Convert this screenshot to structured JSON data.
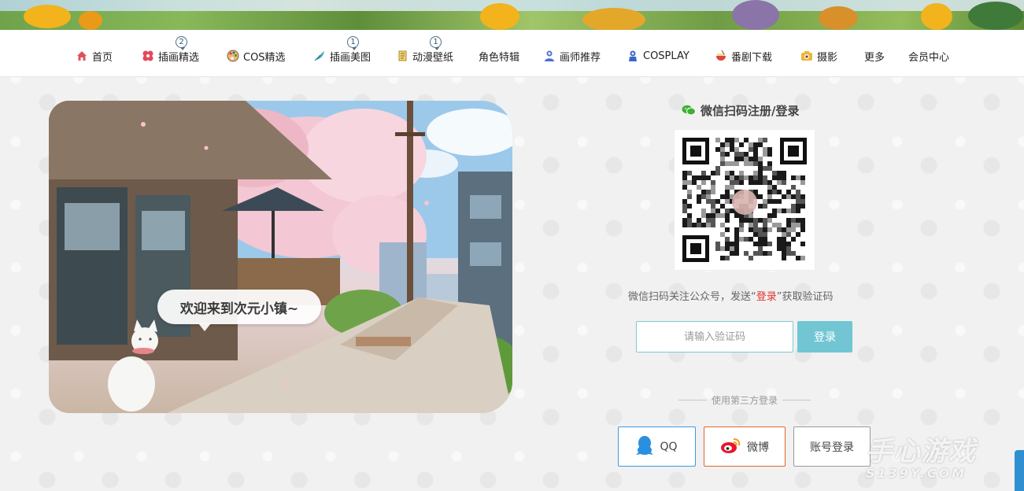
{
  "nav": {
    "items": [
      {
        "label": "首页",
        "icon": "home-icon",
        "badge": ""
      },
      {
        "label": "插画精选",
        "icon": "clover-icon",
        "badge": "2"
      },
      {
        "label": "COS精选",
        "icon": "palette-icon",
        "badge": ""
      },
      {
        "label": "插画美图",
        "icon": "feather-icon",
        "badge": "1"
      },
      {
        "label": "动漫壁纸",
        "icon": "scroll-icon",
        "badge": "1"
      },
      {
        "label": "角色特辑",
        "icon": "",
        "badge": ""
      },
      {
        "label": "画师推荐",
        "icon": "artist-icon",
        "badge": ""
      },
      {
        "label": "COSPLAY",
        "icon": "cosplay-icon",
        "badge": ""
      },
      {
        "label": "番剧下载",
        "icon": "bowl-icon",
        "badge": ""
      },
      {
        "label": "摄影",
        "icon": "camera-icon",
        "badge": ""
      },
      {
        "label": "更多",
        "icon": "",
        "badge": ""
      },
      {
        "label": "会员中心",
        "icon": "",
        "badge": ""
      }
    ]
  },
  "hero": {
    "speech": "欢迎来到次元小镇~"
  },
  "login": {
    "title": "微信扫码注册/登录",
    "hint_prefix": "微信扫码关注公众号，发送“",
    "hint_keyword": "登录",
    "hint_suffix": "”获取验证码",
    "code_placeholder": "请输入验证码",
    "code_value": "",
    "submit_label": "登录",
    "third_party_label": "使用第三方登录",
    "qq_label": "QQ",
    "weibo_label": "微博",
    "account_label": "账号登录"
  },
  "watermark": {
    "line1": "手心游戏",
    "line2": "S139Y.COM"
  },
  "colors": {
    "accent": "#72c6d4",
    "qq": "#3a9be0",
    "weibo": "#e0642c",
    "keyword": "#e0342f",
    "wechat": "#3cb035"
  }
}
